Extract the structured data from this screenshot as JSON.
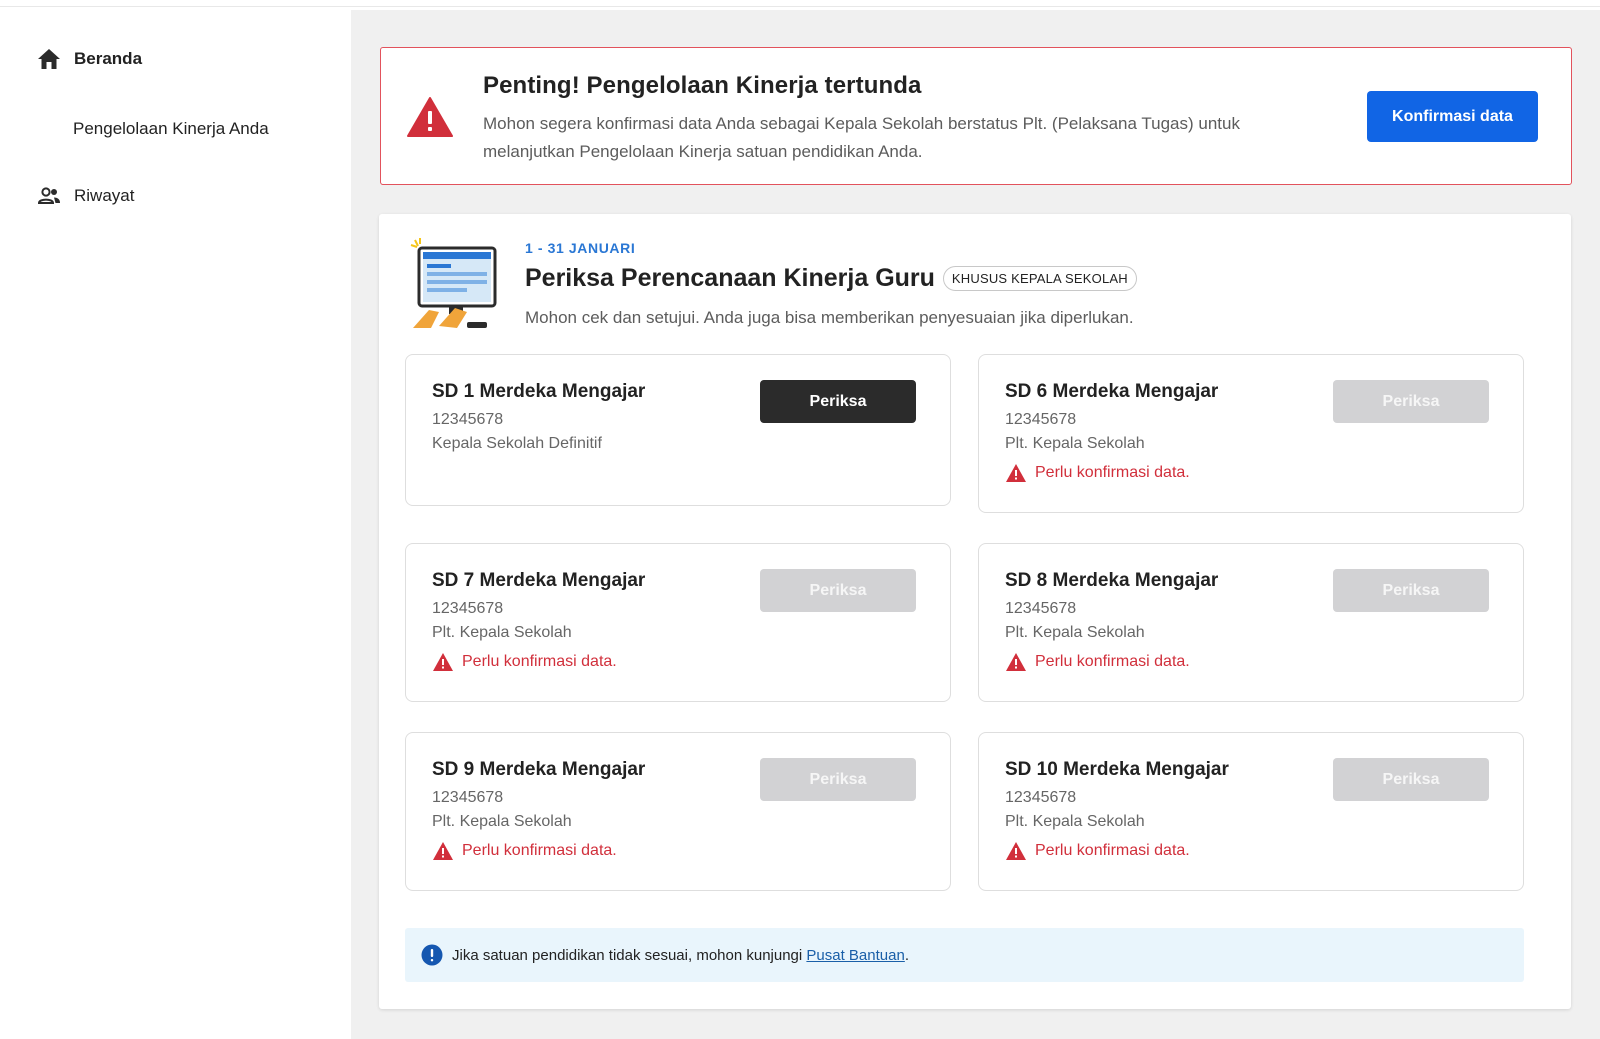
{
  "sidebar": {
    "items": [
      {
        "label": "Beranda",
        "icon": "home-icon"
      },
      {
        "label": "Pengelolaan Kinerja Anda"
      },
      {
        "label": "Riwayat",
        "icon": "people-icon"
      }
    ]
  },
  "alert": {
    "title": "Penting! Pengelolaan Kinerja tertunda",
    "description": "Mohon segera konfirmasi data Anda sebagai Kepala Sekolah berstatus Plt. (Pelaksana Tugas) untuk melanjutkan Pengelolaan Kinerja satuan pendidikan Anda.",
    "button_label": "Konfirmasi data",
    "icon": "warning-icon",
    "border_color": "#e2525c",
    "button_color": "#1165e5"
  },
  "section": {
    "date": "1 - 31 JANUARI",
    "title": "Periksa Perencanaan Kinerja Guru",
    "badge": "KHUSUS KEPALA SEKOLAH",
    "description": "Mohon cek dan setujui. Anda juga bisa memberikan penyesuaian jika diperlukan."
  },
  "schools": [
    {
      "name": "SD 1 Merdeka Mengajar",
      "npsn": "12345678",
      "role": "Kepala Sekolah Definitif",
      "warning": "",
      "button": "Periksa",
      "enabled": true
    },
    {
      "name": "SD 6 Merdeka Mengajar",
      "npsn": "12345678",
      "role": "Plt. Kepala Sekolah",
      "warning": "Perlu konfirmasi data.",
      "button": "Periksa",
      "enabled": false
    },
    {
      "name": "SD 7 Merdeka Mengajar",
      "npsn": "12345678",
      "role": "Plt. Kepala Sekolah",
      "warning": "Perlu konfirmasi data.",
      "button": "Periksa",
      "enabled": false
    },
    {
      "name": "SD 8 Merdeka Mengajar",
      "npsn": "12345678",
      "role": "Plt. Kepala Sekolah",
      "warning": "Perlu konfirmasi data.",
      "button": "Periksa",
      "enabled": false
    },
    {
      "name": "SD 9 Merdeka Mengajar",
      "npsn": "12345678",
      "role": "Plt. Kepala Sekolah",
      "warning": "Perlu konfirmasi data.",
      "button": "Periksa",
      "enabled": false
    },
    {
      "name": "SD 10 Merdeka Mengajar",
      "npsn": "12345678",
      "role": "Plt. Kepala Sekolah",
      "warning": "Perlu konfirmasi data.",
      "button": "Periksa",
      "enabled": false
    }
  ],
  "info": {
    "text_before": "Jika satuan pendidikan tidak sesuai, mohon kunjungi ",
    "link": "Pusat Bantuan",
    "text_after": ".",
    "icon": "info-icon"
  }
}
